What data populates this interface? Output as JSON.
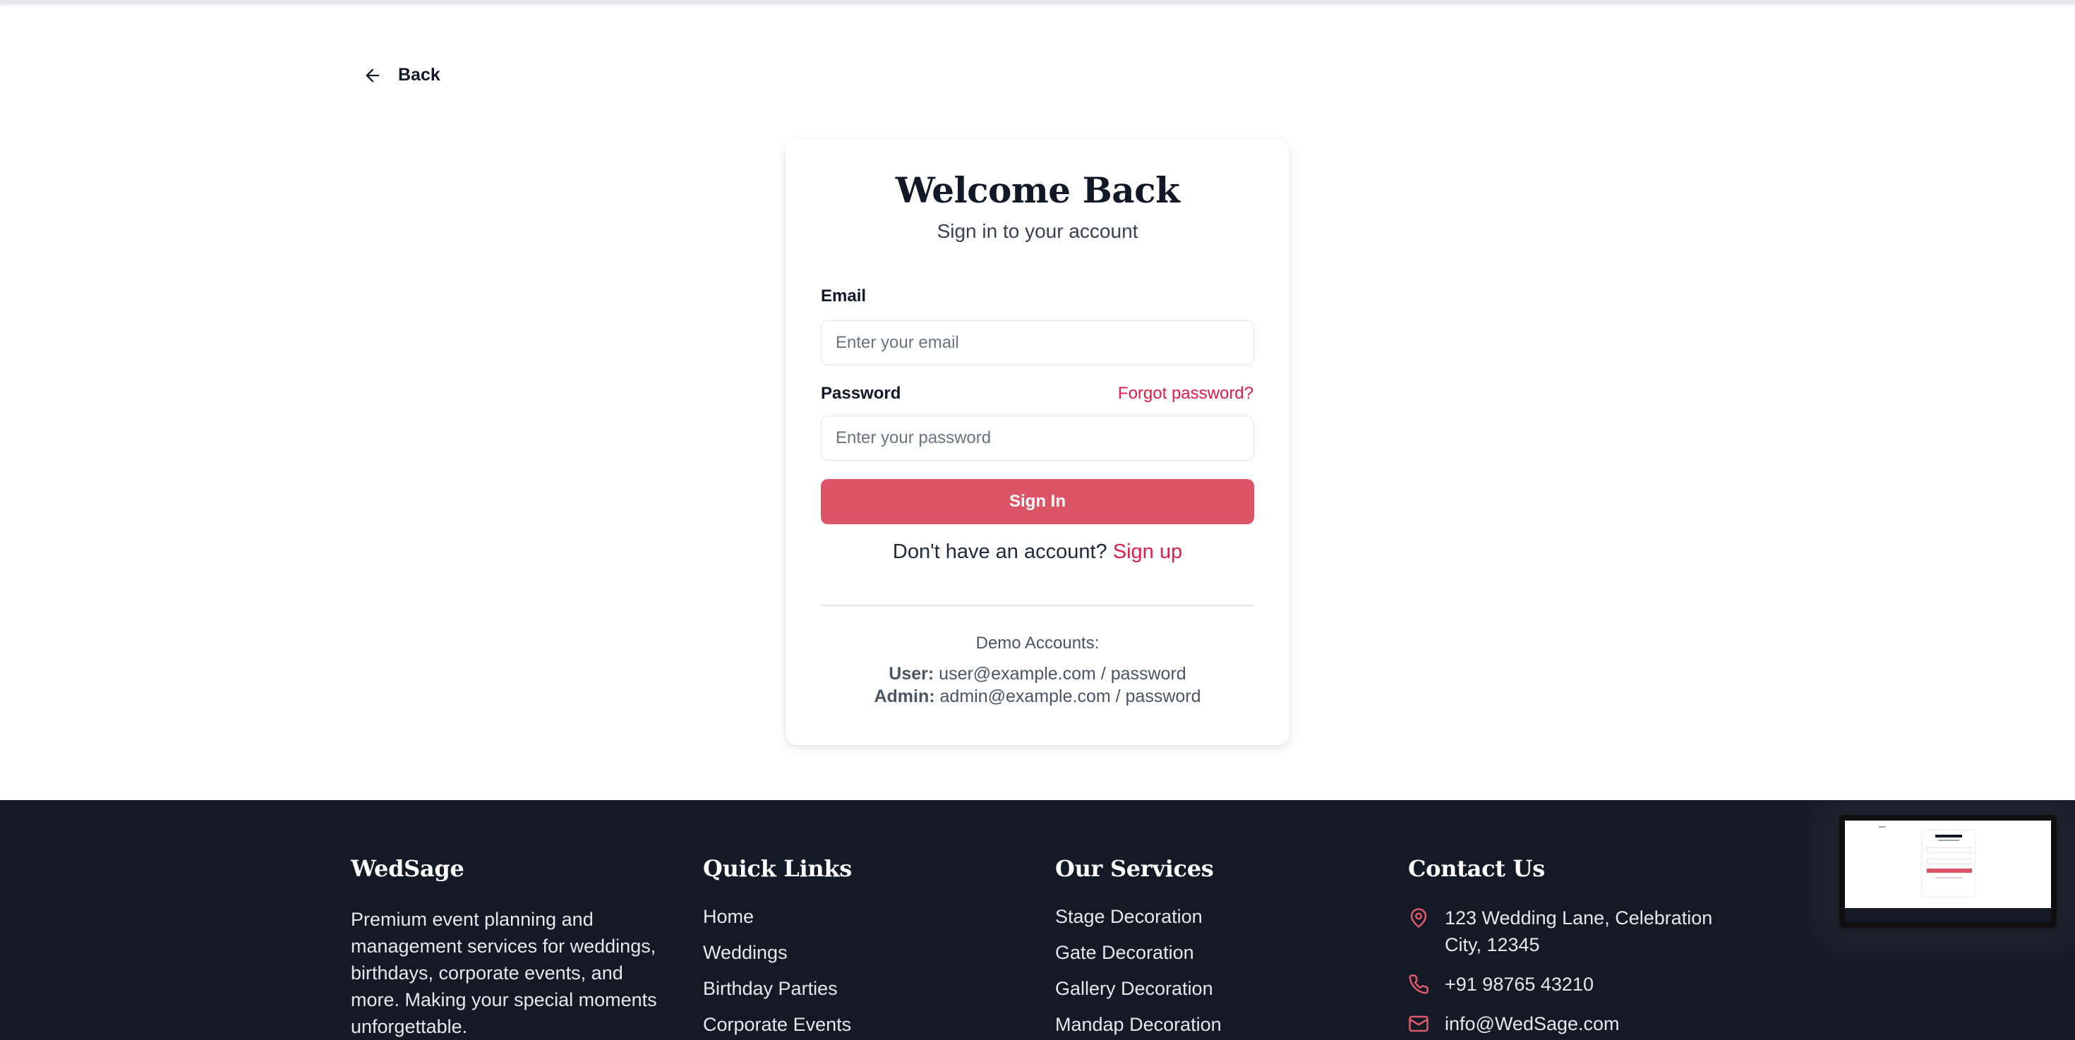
{
  "nav": {
    "back_label": "Back"
  },
  "login": {
    "title": "Welcome Back",
    "subtitle": "Sign in to your account",
    "email_label": "Email",
    "email_placeholder": "Enter your email",
    "password_label": "Password",
    "forgot_label": "Forgot password?",
    "password_placeholder": "Enter your password",
    "signin_label": "Sign In",
    "no_account_text": "Don't have an account?",
    "signup_label": "Sign up",
    "demo_title": "Demo Accounts:",
    "demo_user_role": "User:",
    "demo_user_creds": "user@example.com / password",
    "demo_admin_role": "Admin:",
    "demo_admin_creds": "admin@example.com / password"
  },
  "footer": {
    "brand": {
      "title": "WedSage",
      "description": "Premium event planning and management services for weddings, birthdays, corporate events, and more. Making your special moments unforgettable."
    },
    "quick_links": {
      "title": "Quick Links",
      "items": [
        "Home",
        "Weddings",
        "Birthday Parties",
        "Corporate Events"
      ]
    },
    "services": {
      "title": "Our Services",
      "items": [
        "Stage Decoration",
        "Gate Decoration",
        "Gallery Decoration",
        "Mandap Decoration"
      ]
    },
    "contact": {
      "title": "Contact Us",
      "address": "123 Wedding Lane, Celebration City, 12345",
      "phone": "+91 98765 43210",
      "email": "info@WedSage.com"
    }
  },
  "colors": {
    "accent": "#dc5566",
    "link": "#e11d48",
    "footer_bg": "#141926",
    "icon_accent": "#e05a6d"
  },
  "icons": {
    "back": "arrow-left-icon",
    "address": "map-pin-icon",
    "phone": "phone-icon",
    "email": "mail-icon"
  }
}
